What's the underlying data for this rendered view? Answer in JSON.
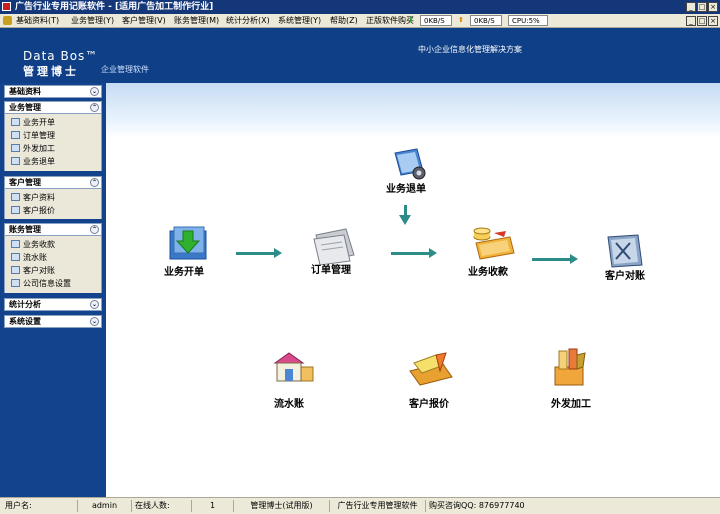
{
  "window": {
    "title": "广告行业专用记账软件 - [适用广告加工制作行业]",
    "buttons": {
      "min": "_",
      "max": "□",
      "close": "×"
    }
  },
  "menubar": {
    "items": [
      "基础资料(T)",
      "业务管理(Y)",
      "客户管理(V)",
      "账务管理(M)",
      "统计分析(X)",
      "系统管理(Y)",
      "帮助(Z)",
      "正版软件购买"
    ],
    "download_speed": "0KB/S",
    "upload_speed": "0KB/S",
    "cpu": "CPU:5%",
    "buttons": {
      "min": "_",
      "max": "□",
      "close": "×"
    }
  },
  "header": {
    "brand_en": "Data Bos™",
    "brand_cn": "管理博士",
    "brand_sub": "企业管理软件",
    "slogan": "中小企业信息化管理解决方案"
  },
  "sidebar": {
    "groups": [
      {
        "title": "基础资料",
        "items": []
      },
      {
        "title": "业务管理",
        "items": [
          "业务开单",
          "订单管理",
          "外发加工",
          "业务退单"
        ]
      },
      {
        "title": "客户管理",
        "items": [
          "客户资料",
          "客户报价"
        ]
      },
      {
        "title": "账务管理",
        "items": [
          "业务收款",
          "流水账",
          "客户对账",
          "公司信息设置"
        ]
      },
      {
        "title": "统计分析",
        "items": []
      },
      {
        "title": "系统设置",
        "items": []
      }
    ]
  },
  "flow": {
    "business_order": "业务开单",
    "order_manage": "订单管理",
    "business_return": "业务退单",
    "business_receipt": "业务收款",
    "customer_reconcile": "客户对账",
    "journal": "流水账",
    "customer_quote": "客户报价",
    "outsource": "外发加工"
  },
  "statusbar": {
    "user_label": "用户名:",
    "user_value": "admin",
    "online_label": "在线人数:",
    "online_value": "1",
    "product": "管理博士(试用版)",
    "industry": "广告行业专用管理软件",
    "contact": "购买咨询QQ: 876977740"
  }
}
